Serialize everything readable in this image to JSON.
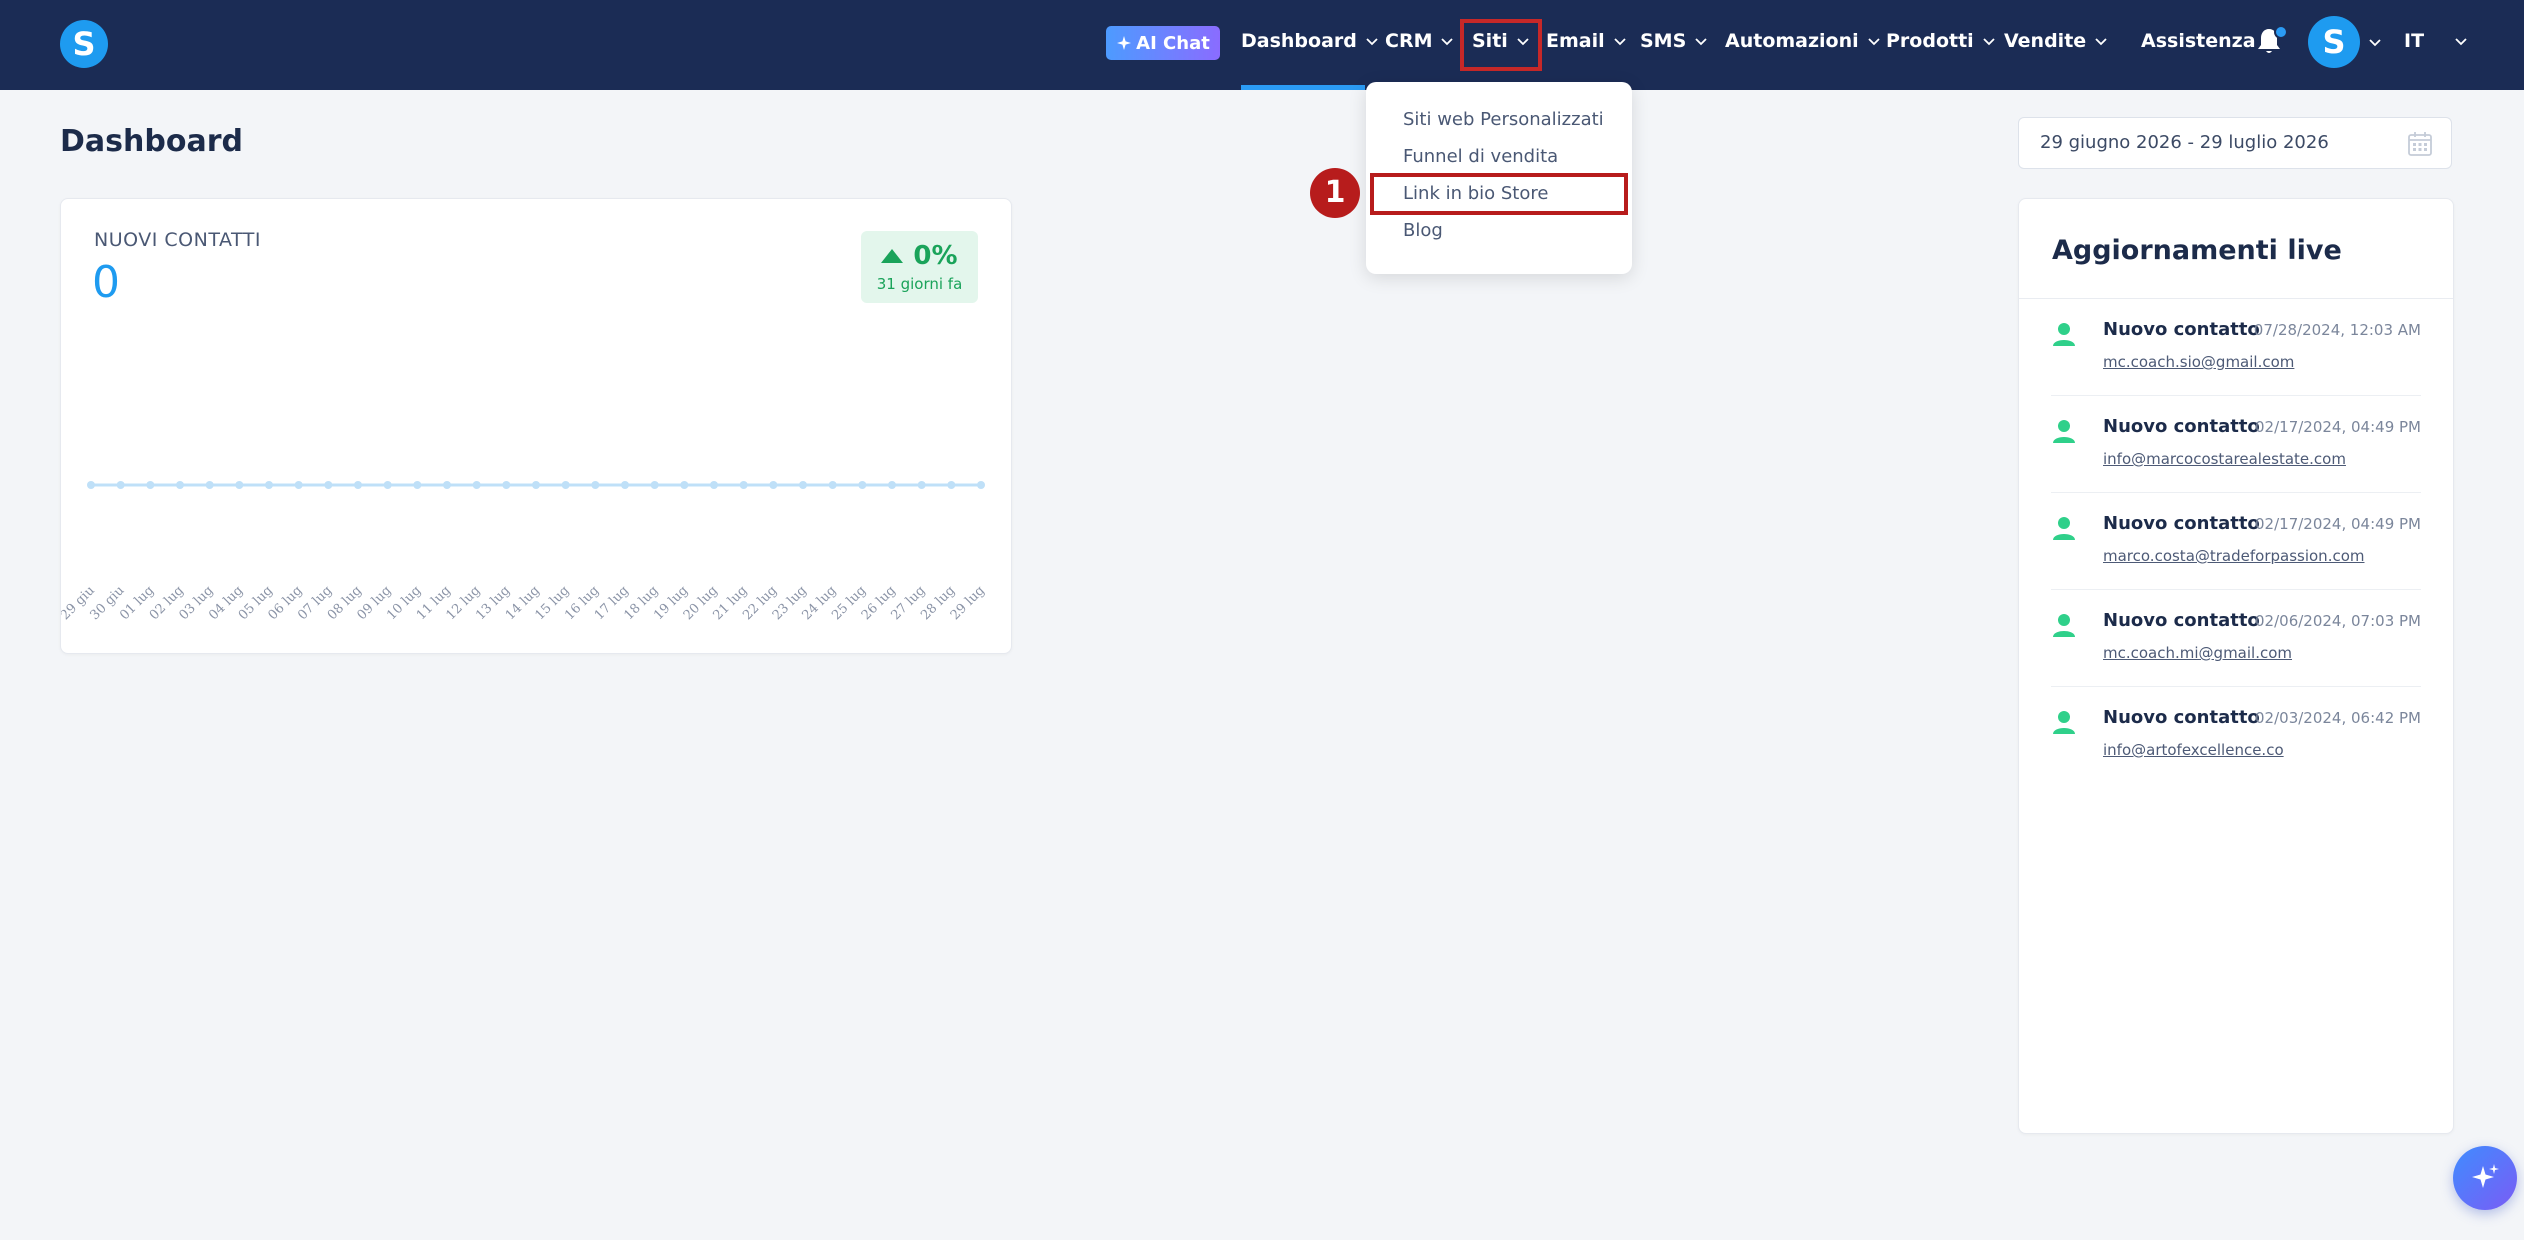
{
  "topbar": {
    "logo_letter": "S",
    "ai_chat_label": "AI Chat",
    "nav": [
      {
        "label": "Dashboard"
      },
      {
        "label": "CRM"
      },
      {
        "label": "Siti"
      },
      {
        "label": "Email"
      },
      {
        "label": "SMS"
      },
      {
        "label": "Automazioni"
      },
      {
        "label": "Prodotti"
      },
      {
        "label": "Vendite"
      }
    ],
    "assistenza_label": "Assistenza",
    "avatar_letter": "S",
    "language": "IT",
    "colors": {
      "bar": "#1b2c55",
      "accent": "#2b9bf4"
    }
  },
  "siti_menu": {
    "items": [
      {
        "label": "Siti web Personalizzati"
      },
      {
        "label": "Funnel di vendita"
      },
      {
        "label": "Link in bio Store"
      },
      {
        "label": "Blog"
      }
    ],
    "step_badge": "1"
  },
  "page": {
    "title": "Dashboard",
    "date_range": "29 giugno 2026 - 29 luglio 2026"
  },
  "contacts_card": {
    "label": "NUOVI CONTATTI",
    "value": "0",
    "trend_pct": "0%",
    "trend_sub": "31 giorni fa"
  },
  "chart_data": {
    "type": "line",
    "categories": [
      "29 giu",
      "30 giu",
      "01 lug",
      "02 lug",
      "03 lug",
      "04 lug",
      "05 lug",
      "06 lug",
      "07 lug",
      "08 lug",
      "09 lug",
      "10 lug",
      "11 lug",
      "12 lug",
      "13 lug",
      "14 lug",
      "15 lug",
      "16 lug",
      "17 lug",
      "18 lug",
      "19 lug",
      "20 lug",
      "21 lug",
      "22 lug",
      "23 lug",
      "24 lug",
      "25 lug",
      "26 lug",
      "27 lug",
      "28 lug",
      "29 lug"
    ],
    "values": [
      0,
      0,
      0,
      0,
      0,
      0,
      0,
      0,
      0,
      0,
      0,
      0,
      0,
      0,
      0,
      0,
      0,
      0,
      0,
      0,
      0,
      0,
      0,
      0,
      0,
      0,
      0,
      0,
      0,
      0,
      0
    ],
    "title": "",
    "xlabel": "",
    "ylabel": "",
    "color": "#bfe0f8"
  },
  "live_updates": {
    "title": "Aggiornamenti live",
    "items": [
      {
        "name": "Nuovo contatto",
        "time": "07/28/2024, 12:03 AM",
        "email": "mc.coach.sio@gmail.com"
      },
      {
        "name": "Nuovo contatto",
        "time": "02/17/2024, 04:49 PM",
        "email": "info@marcocostarealestate.com"
      },
      {
        "name": "Nuovo contatto",
        "time": "02/17/2024, 04:49 PM",
        "email": "marco.costa@tradeforpassion.com"
      },
      {
        "name": "Nuovo contatto",
        "time": "02/06/2024, 07:03 PM",
        "email": "mc.coach.mi@gmail.com"
      },
      {
        "name": "Nuovo contatto",
        "time": "02/03/2024, 06:42 PM",
        "email": "info@artofexcellence.co"
      }
    ]
  },
  "icons": {
    "bell": "bell-icon",
    "calendar": "calendar-icon",
    "person": "person-icon",
    "sparkle": "sparkle-icon"
  }
}
